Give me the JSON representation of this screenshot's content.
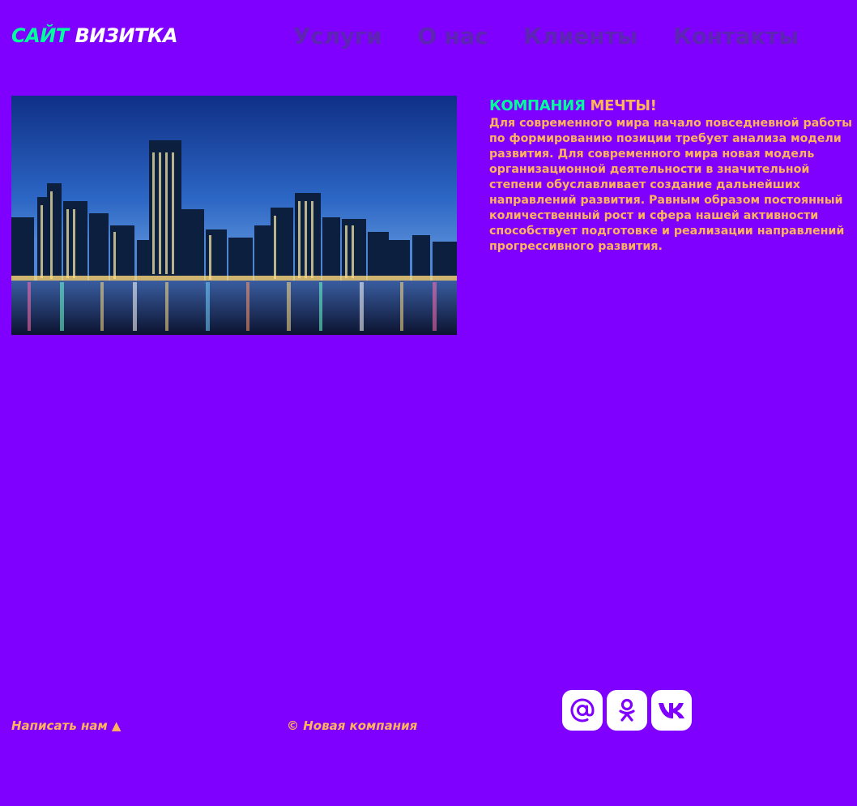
{
  "logo": {
    "word1": "САЙТ",
    "word2": "ВИЗИТКА"
  },
  "nav": {
    "items": [
      {
        "label": "Услуги"
      },
      {
        "label": "О нас"
      },
      {
        "label": "Клиенты"
      },
      {
        "label": "Контакты"
      }
    ]
  },
  "hero": {
    "icon": "city-skyline-image"
  },
  "content": {
    "title_part1": "КОМПАНИЯ",
    "title_part2": "МЕЧТЫ!",
    "body": "Для современного мира начало повседневной работы по формированию позиции требует анализа модели развития. Для современного мира новая модель организационной деятельности в значительной степени обуславливает создание дальнейших направлений развития. Равным образом постоянный количественный рост и сфера нашей активности способствует подготовке и реализации направлений прогрессивного развития."
  },
  "footer": {
    "contact_label": "Написать нам ▲",
    "copyright": "© Новая компания",
    "socials": [
      {
        "icon": "mail-at-icon"
      },
      {
        "icon": "odnoklassniki-icon"
      },
      {
        "icon": "vk-icon"
      }
    ]
  },
  "colors": {
    "background": "#8000ff",
    "accent_green": "#00ff9c",
    "accent_orange": "#ffb35a",
    "nav_text": "#5e24b4"
  }
}
